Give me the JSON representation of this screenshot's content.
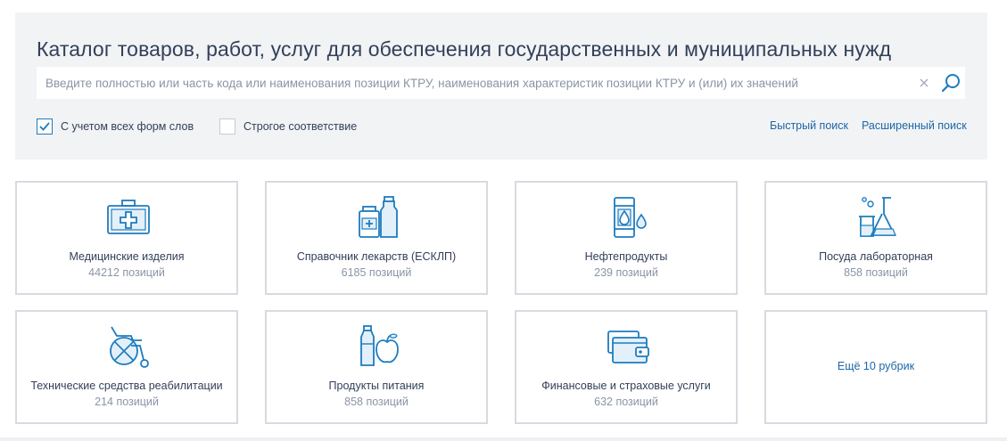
{
  "header": {
    "title": "Каталог товаров, работ, услуг для обеспечения государственных и муниципальных нужд"
  },
  "search": {
    "placeholder": "Введите полностью или часть кода или наименования позиции КТРУ, наименования характеристик позиции КТРУ и (или) их значений",
    "value": ""
  },
  "options": {
    "word_forms": {
      "label": "С учетом всех форм слов",
      "checked": true
    },
    "strict": {
      "label": "Строгое соответствие",
      "checked": false
    }
  },
  "links": {
    "quick_search": "Быстрый поиск",
    "advanced_search": "Расширенный поиск"
  },
  "categories": [
    {
      "title": "Медицинские изделия",
      "count": "44212 позиций",
      "icon": "medical-kit-icon"
    },
    {
      "title": "Справочник лекарств (ЕСКЛП)",
      "count": "6185 позиций",
      "icon": "medicine-bottles-icon"
    },
    {
      "title": "Нефтепродукты",
      "count": "239 позиций",
      "icon": "oil-barrel-icon"
    },
    {
      "title": "Посуда лабораторная",
      "count": "858 позиций",
      "icon": "lab-flask-icon"
    },
    {
      "title": "Технические средства реабилитации",
      "count": "214 позиций",
      "icon": "wheelchair-icon"
    },
    {
      "title": "Продукты питания",
      "count": "858 позиций",
      "icon": "food-bottle-apple-icon"
    },
    {
      "title": "Финансовые и страховые услуги",
      "count": "632 позиций",
      "icon": "wallet-icon"
    }
  ],
  "more": {
    "label": "Ещё 10 рубрик"
  },
  "colors": {
    "accent": "#1d7cbf",
    "link": "#1d66a8",
    "panel_bg": "#f1f3f5",
    "card_border": "#d7dbe0",
    "text": "#334059",
    "muted": "#8a94a6"
  }
}
